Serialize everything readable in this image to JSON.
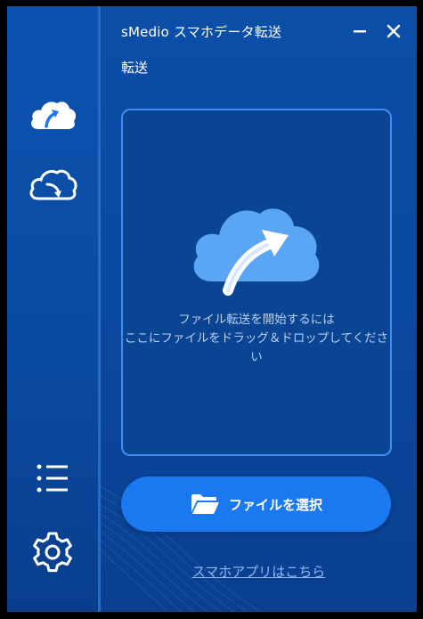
{
  "window": {
    "title": "sMedio スマホデータ転送"
  },
  "sidebar": {
    "items": [
      {
        "icon": "cloud-upload-icon",
        "active": true
      },
      {
        "icon": "cloud-download-icon",
        "active": false
      },
      {
        "icon": "list-icon",
        "active": false
      },
      {
        "icon": "gear-icon",
        "active": false
      }
    ]
  },
  "main": {
    "section_title": "転送",
    "dropzone": {
      "icon": "cloud-upload-large-icon",
      "line1": "ファイル転送を開始するには",
      "line2": "ここにファイルをドラッグ＆ドロップしてください"
    },
    "select_button_label": "ファイルを選択",
    "app_link_label": "スマホアプリはこちら"
  },
  "colors": {
    "background": "#0a49a0",
    "accent": "#1a78f0",
    "dropzone_border": "#3d8ef0",
    "link": "#8fb8ee"
  }
}
